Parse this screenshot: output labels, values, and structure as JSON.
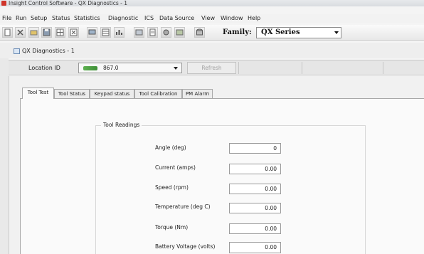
{
  "window": {
    "title": "Insight Control Software - QX Diagnostics - 1"
  },
  "menu": [
    "File",
    "Run",
    "Setup",
    "Status",
    "Statistics",
    "Diagnostic",
    "ICS",
    "Data Source",
    "View",
    "Window",
    "Help"
  ],
  "toolbar": {
    "family_label": "Family:",
    "family_value": "QX Series"
  },
  "child": {
    "title": "QX Diagnostics - 1",
    "location_label": "Location ID",
    "location_value": "867.0",
    "refresh_label": "Refresh"
  },
  "tabs": [
    "Tool Test",
    "Tool Status",
    "Keypad status",
    "Tool Calibration",
    "PM Alarm"
  ],
  "readings": {
    "title": "Tool Readings",
    "rows": [
      {
        "label": "Angle (deg)",
        "value": "0"
      },
      {
        "label": "Current (amps)",
        "value": "0.00"
      },
      {
        "label": "Speed (rpm)",
        "value": "0.00"
      },
      {
        "label": "Temperature (deg C)",
        "value": "0.00"
      },
      {
        "label": "Torque (Nm)",
        "value": "0.00"
      },
      {
        "label": "Battery Voltage (volts)",
        "value": "0.00"
      }
    ]
  },
  "colors": {
    "app_icon": "#d0352a",
    "network": "#4fa044"
  }
}
